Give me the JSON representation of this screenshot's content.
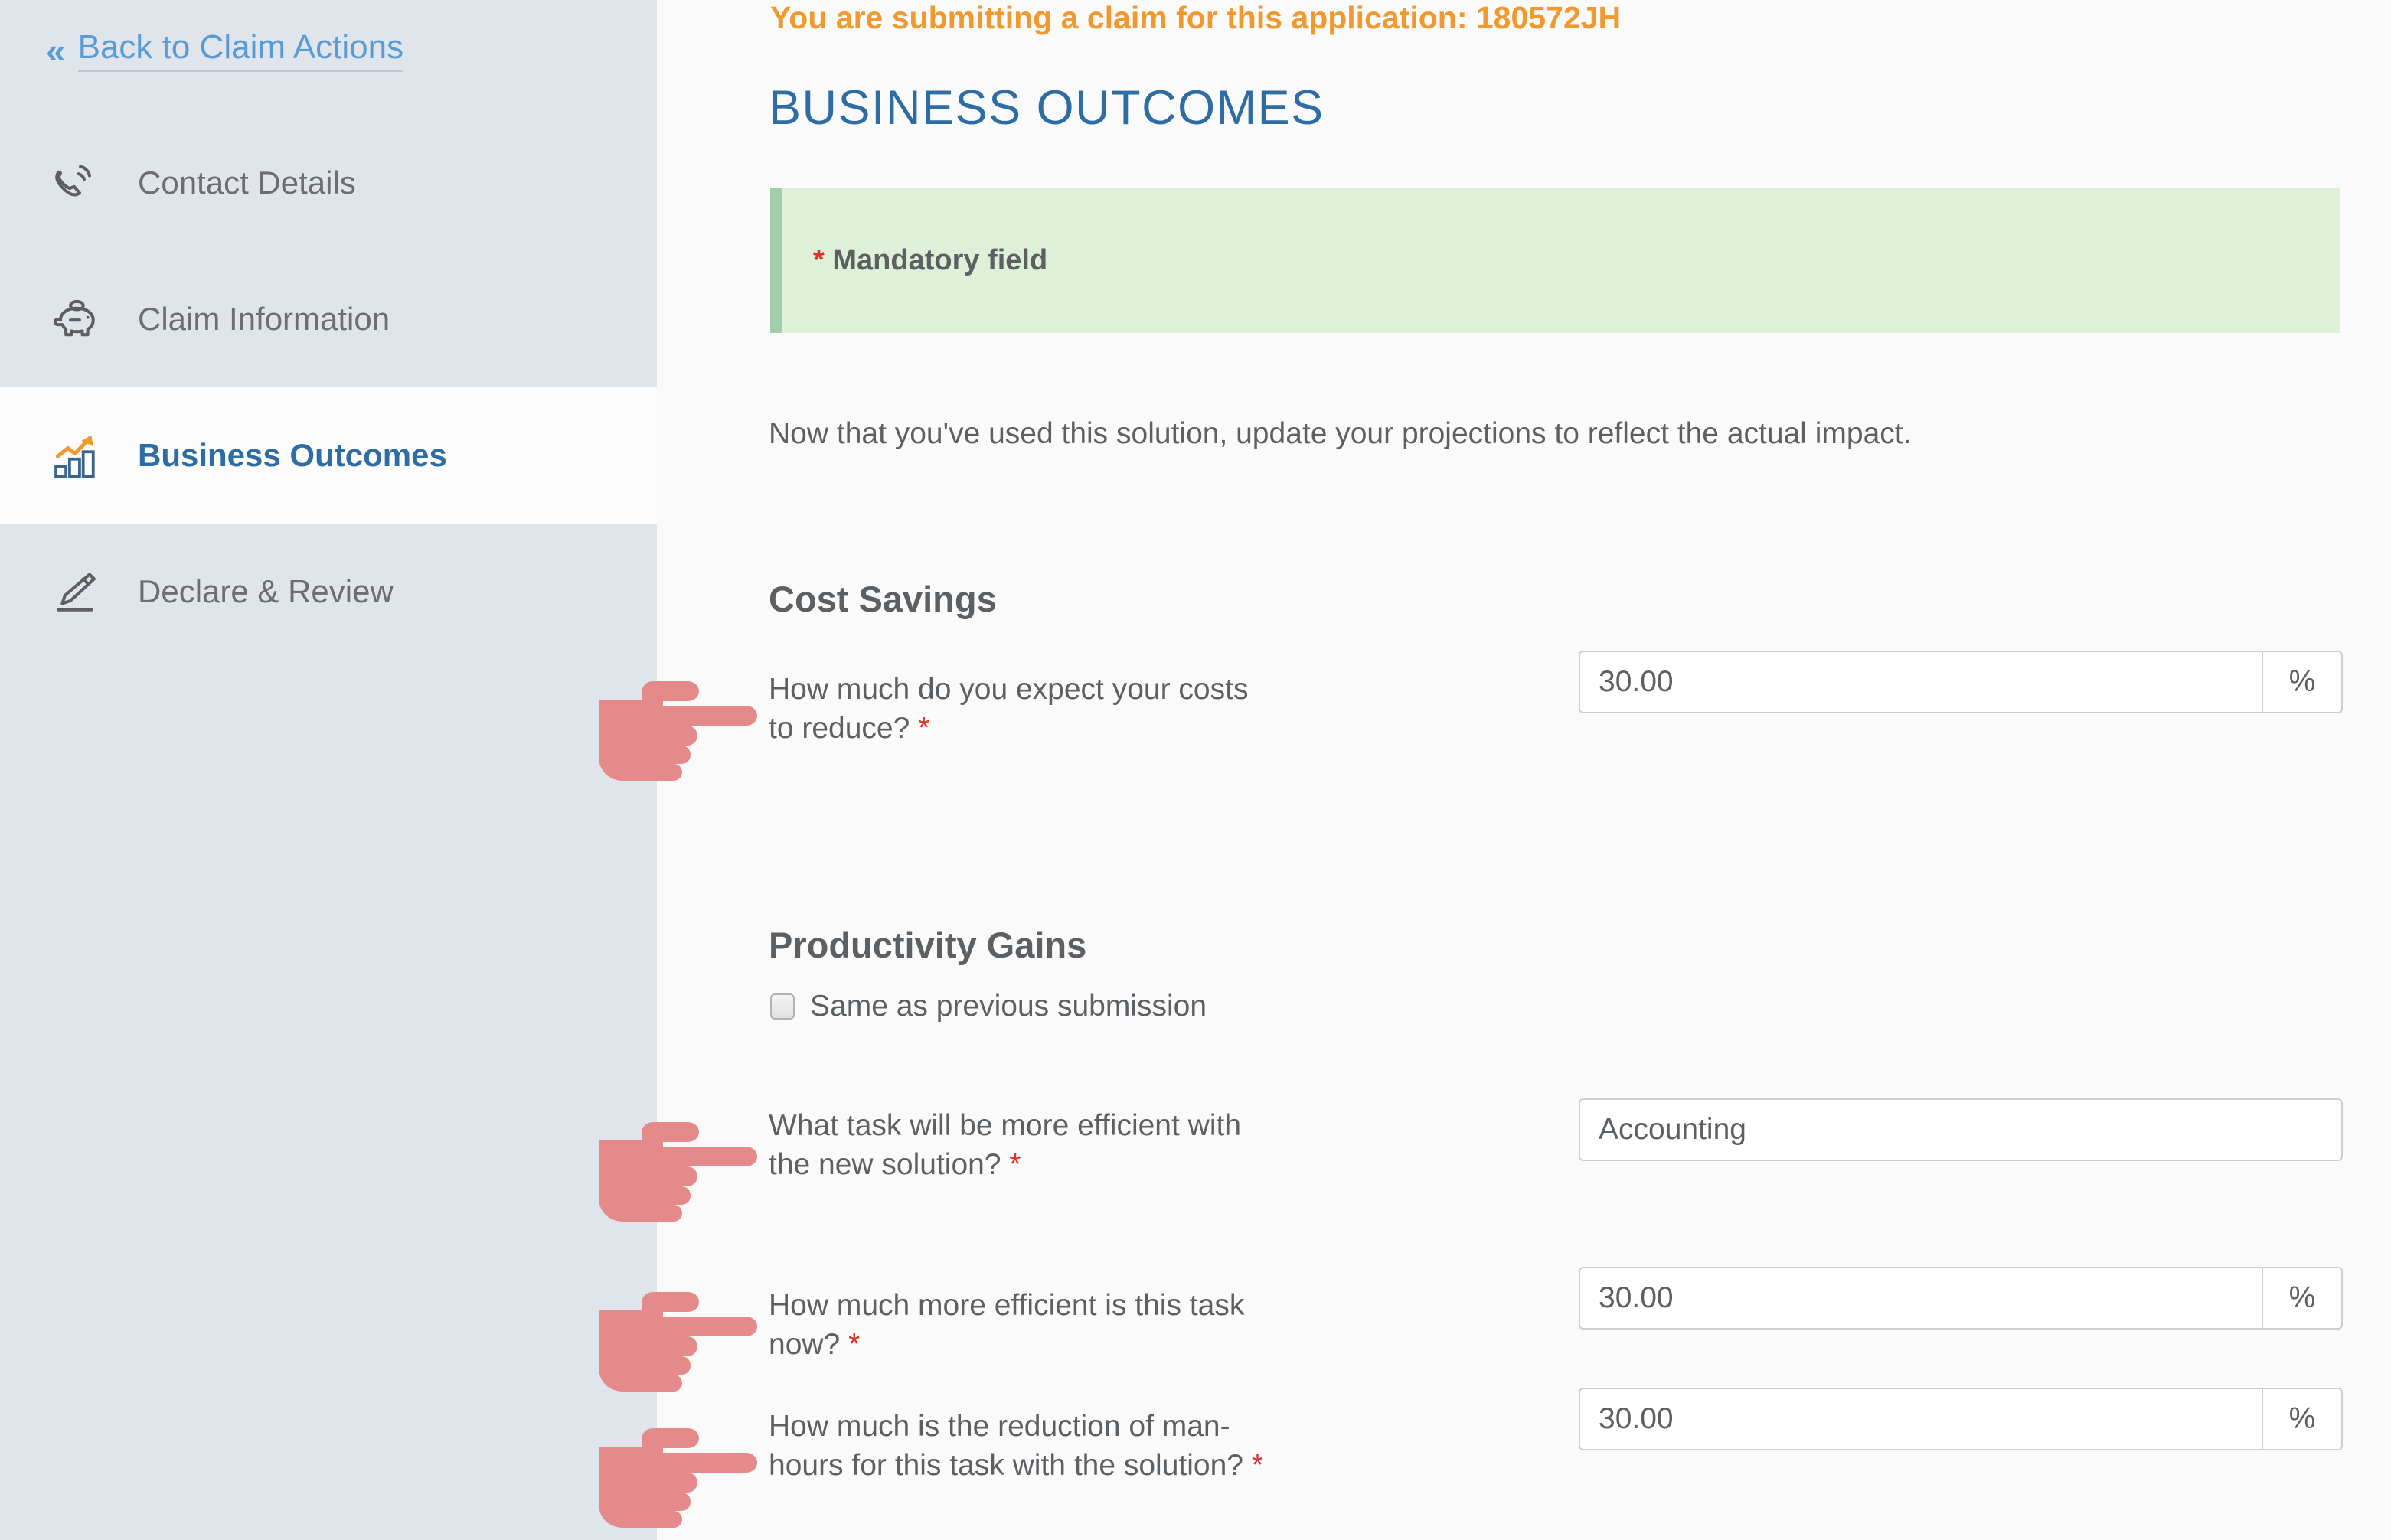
{
  "sidebar": {
    "back_link": {
      "label": "Back to Claim Actions",
      "chevron": "«"
    },
    "items": [
      {
        "label": "Contact Details",
        "icon": "phone-icon",
        "active": false
      },
      {
        "label": "Claim Information",
        "icon": "piggy-bank-icon",
        "active": false
      },
      {
        "label": "Business Outcomes",
        "icon": "bar-chart-icon",
        "active": true
      },
      {
        "label": "Declare & Review",
        "icon": "pen-icon",
        "active": false
      }
    ]
  },
  "main": {
    "application_notice": "You are submitting a claim for this application: 180572JH",
    "page_title": "BUSINESS OUTCOMES",
    "mandatory_banner": {
      "star": "*",
      "text": "Mandatory field"
    },
    "intro_text": "Now that you've used this solution, update your projections to reflect the actual impact.",
    "sections": [
      {
        "heading": "Cost Savings",
        "fields": [
          {
            "label": "How much do you expect your costs to reduce?",
            "required_marker": "*",
            "value": "30.00",
            "suffix": "%"
          }
        ]
      },
      {
        "heading": "Productivity Gains",
        "checkbox": {
          "label": "Same as previous submission",
          "checked": false
        },
        "fields": [
          {
            "label": "What task will be more efficient with the new solution?",
            "required_marker": "*",
            "value": "Accounting",
            "suffix": ""
          },
          {
            "label": "How much more efficient is this task now?",
            "required_marker": "*",
            "value": "30.00",
            "suffix": "%"
          },
          {
            "label": "How much is the reduction of man-hours for this task with the solution?",
            "required_marker": "*",
            "value": "30.00",
            "suffix": "%"
          }
        ]
      }
    ]
  },
  "colors": {
    "sidebar_bg": "#dfe5ea",
    "sidebar_active_bg": "#fcfcfc",
    "accent_blue": "#2e6da4",
    "link_blue": "#5b9bd5",
    "notice_orange": "#f0992e",
    "banner_green_bg": "#dff0d8",
    "banner_green_border": "#a3ceaa",
    "required_red": "#d9342b",
    "text_gray": "#5d6063",
    "cursor_pink": "#e58a8a",
    "page_bg": "#fafafa"
  },
  "cursors": [
    {
      "name": "pointing-hand-cursor-cost-savings"
    },
    {
      "name": "pointing-hand-cursor-task-efficient"
    },
    {
      "name": "pointing-hand-cursor-efficiency-percent"
    },
    {
      "name": "pointing-hand-cursor-man-hours"
    }
  ]
}
